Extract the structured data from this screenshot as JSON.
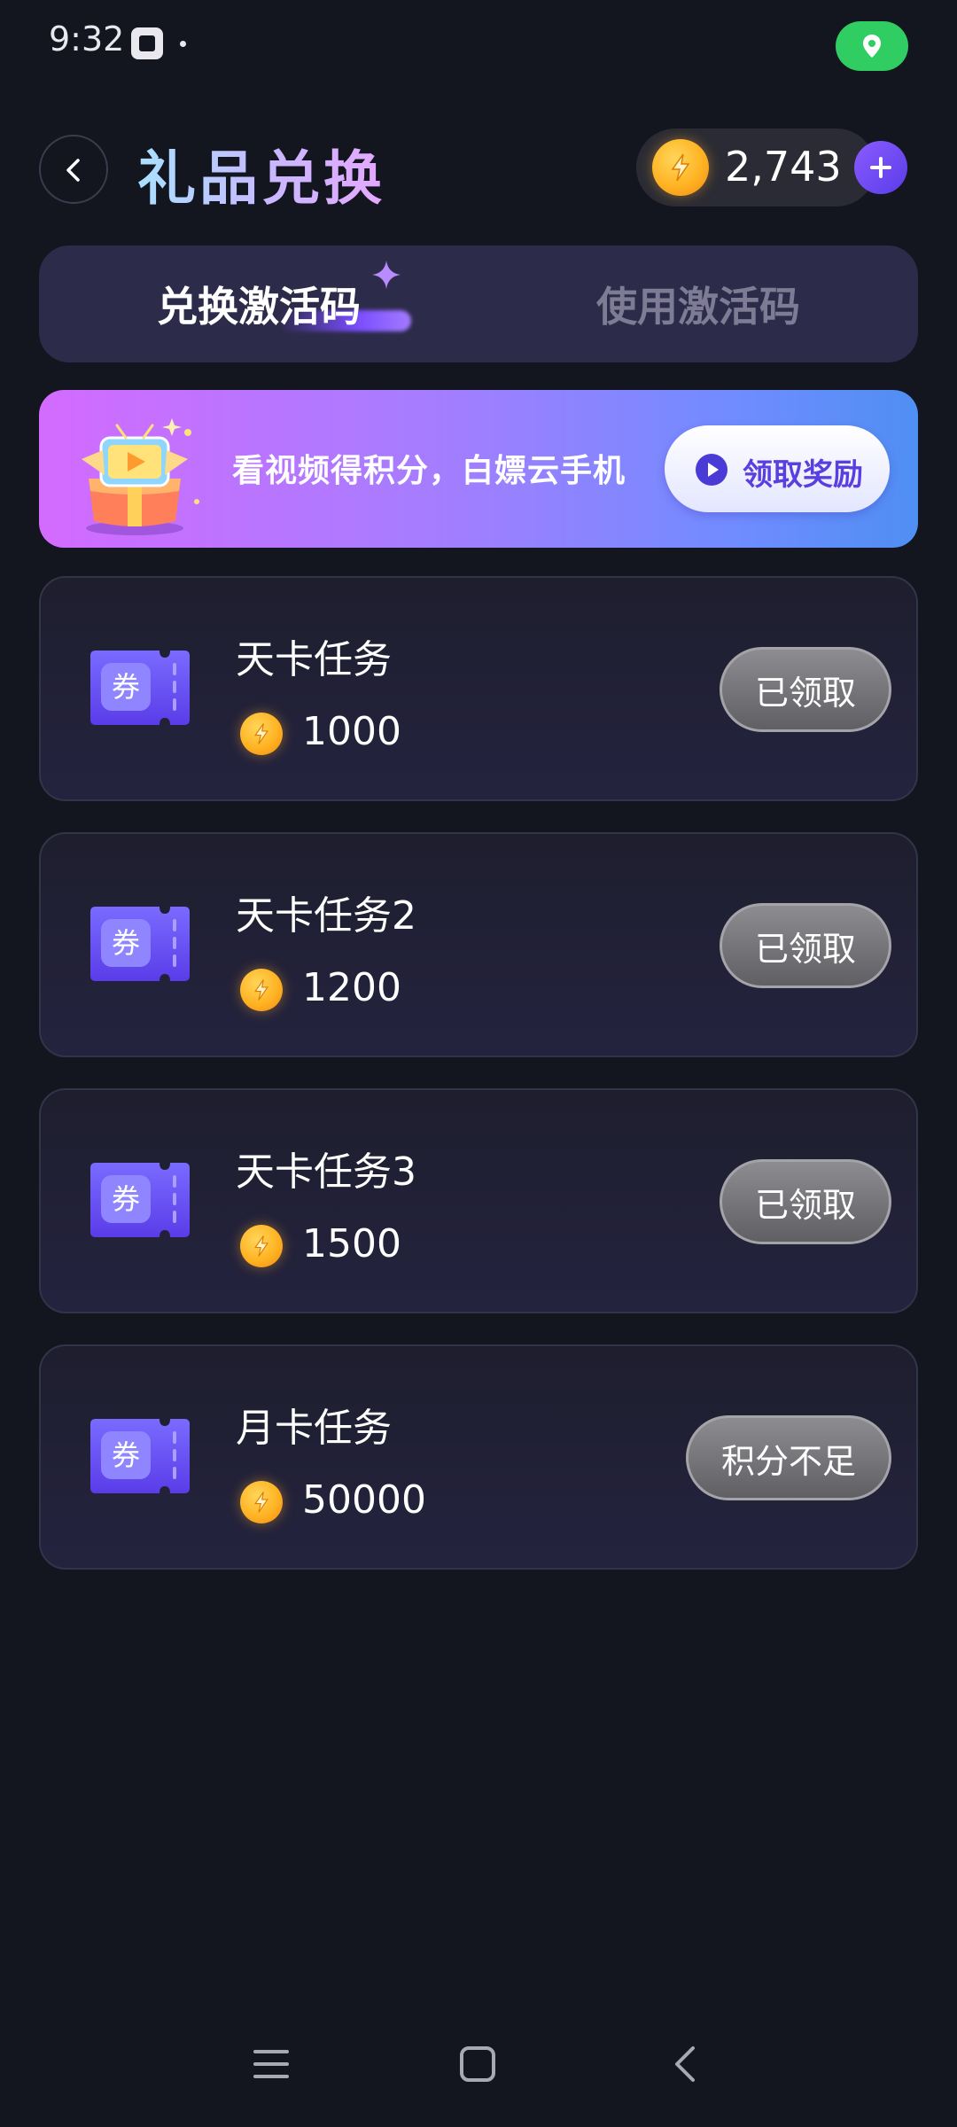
{
  "status_bar": {
    "time": "9:32",
    "icons": [
      "app-notification-icon",
      "dot-icon",
      "location-icon"
    ],
    "location_color": "#2fcd62"
  },
  "header": {
    "title": "礼品兑换",
    "points": "2,743",
    "icons": [
      "back-icon",
      "coin-icon",
      "plus-icon"
    ]
  },
  "tabs": [
    {
      "label": "兑换激活码",
      "active": true
    },
    {
      "label": "使用激活码",
      "active": false
    }
  ],
  "banner": {
    "text": "看视频得积分，白嫖云手机",
    "button_label": "领取奖励",
    "icons": [
      "tv-gift-icon",
      "play-icon"
    ]
  },
  "tasks": [
    {
      "ticket_label": "券",
      "name": "天卡任务",
      "cost": "1000",
      "button_label": "已领取",
      "state": "claimed"
    },
    {
      "ticket_label": "券",
      "name": "天卡任务2",
      "cost": "1200",
      "button_label": "已领取",
      "state": "claimed"
    },
    {
      "ticket_label": "券",
      "name": "天卡任务3",
      "cost": "1500",
      "button_label": "已领取",
      "state": "claimed"
    },
    {
      "ticket_label": "券",
      "name": "月卡任务",
      "cost": "50000",
      "button_label": "积分不足",
      "state": "insufficient"
    }
  ],
  "nav_bar": {
    "icons": [
      "menu-icon",
      "home-icon",
      "back-icon"
    ]
  },
  "colors": {
    "background": "#13151f",
    "accent": "#7a4dff",
    "coin": "#ffb323",
    "card": "#24233f",
    "button_gray": "#7a7a7e"
  }
}
